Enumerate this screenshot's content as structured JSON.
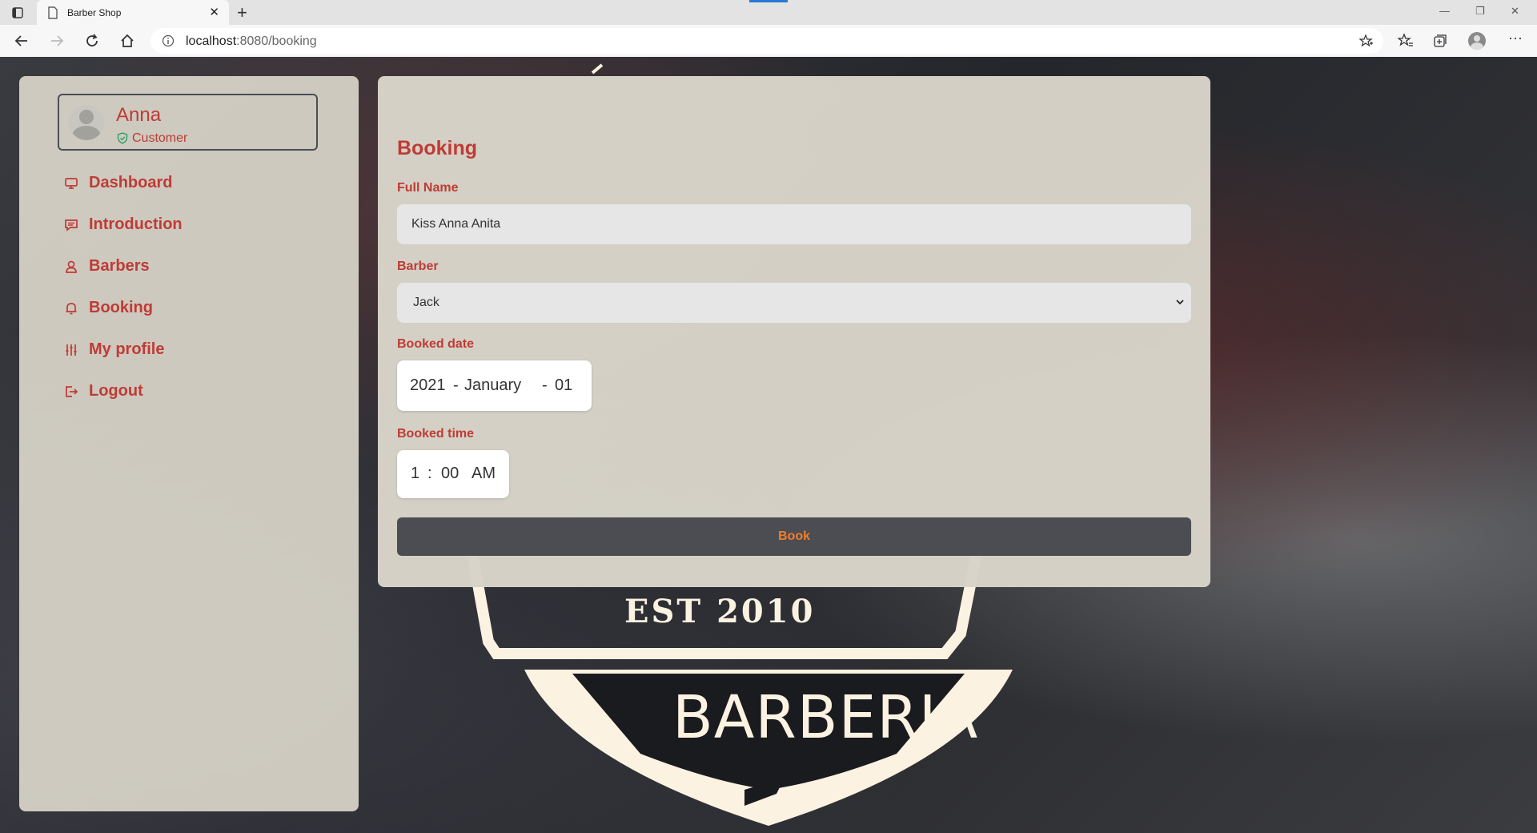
{
  "browser": {
    "tab_title": "Barber Shop",
    "new_tab": "+",
    "url_host": "localhost",
    "url_path": ":8080/booking"
  },
  "background_logo": {
    "est_text": "EST 2010",
    "name_text": "BARBERIA"
  },
  "sidebar": {
    "user": {
      "name": "Anna",
      "role": "Customer"
    },
    "items": [
      {
        "label": "Dashboard",
        "icon": "monitor-icon"
      },
      {
        "label": "Introduction",
        "icon": "message-icon"
      },
      {
        "label": "Barbers",
        "icon": "user-icon"
      },
      {
        "label": "Booking",
        "icon": "bell-icon"
      },
      {
        "label": "My profile",
        "icon": "sliders-icon"
      },
      {
        "label": "Logout",
        "icon": "logout-icon"
      }
    ]
  },
  "booking": {
    "title": "Booking",
    "full_name_label": "Full Name",
    "full_name_value": "Kiss Anna Anita",
    "barber_label": "Barber",
    "barber_value": "Jack",
    "date_label": "Booked date",
    "date_year": "2021",
    "date_month": "January",
    "date_day": "01",
    "date_sep": "-",
    "time_label": "Booked time",
    "time_hour": "1",
    "time_sep": ":",
    "time_minute": "00",
    "time_ampm": "AM",
    "book_button": "Book"
  },
  "colors": {
    "accent_red": "#bf3b35",
    "button_text_orange": "#f07d2a",
    "button_bg": "#4b4d52",
    "panel_bg": "#d7d3c8"
  }
}
